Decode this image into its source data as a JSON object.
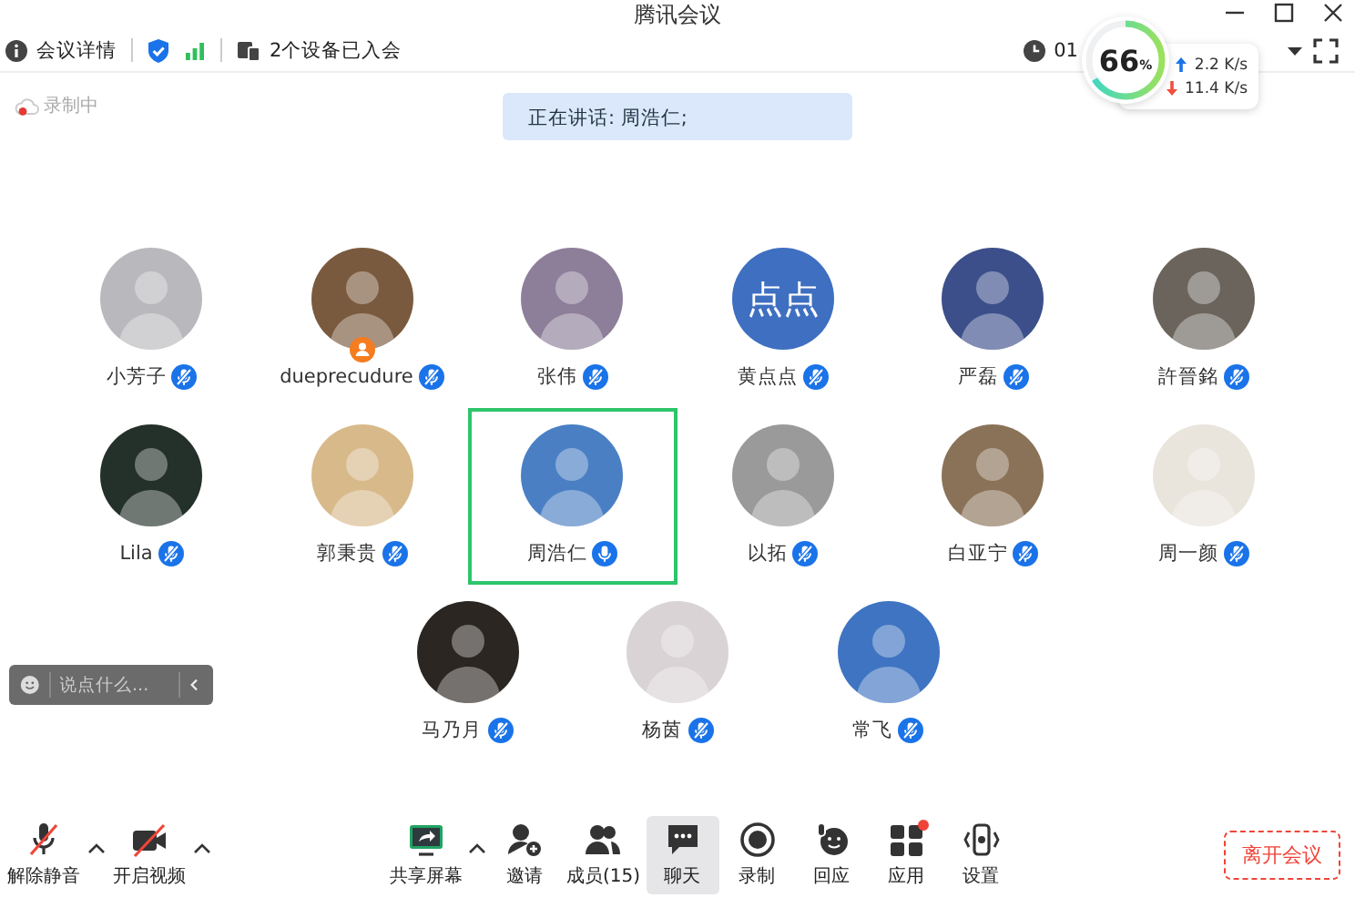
{
  "window": {
    "title": "腾讯会议"
  },
  "info_bar": {
    "details": "会议详情",
    "devices": "2个设备已入会",
    "timer": "01"
  },
  "network": {
    "quality": "66",
    "unit": "%",
    "level": 0.66,
    "upload": "2.2 K/s",
    "download": "11.4 K/s"
  },
  "recording": {
    "label": "录制中"
  },
  "speaker_banner": "正在讲话: 周浩仁;",
  "rows": [
    {
      "participants": [
        {
          "name": "小芳子",
          "muted": true,
          "speaking": false,
          "host": false,
          "avatar": {
            "kind": "photo",
            "color": "#b9b9bd"
          }
        },
        {
          "name": "dueprecudure",
          "muted": true,
          "speaking": false,
          "host": true,
          "avatar": {
            "kind": "photo",
            "color": "#7a5a3e"
          }
        },
        {
          "name": "张伟",
          "muted": true,
          "speaking": false,
          "host": false,
          "avatar": {
            "kind": "photo",
            "color": "#8d7f9a"
          }
        },
        {
          "name": "黄点点",
          "muted": true,
          "speaking": false,
          "host": false,
          "avatar": {
            "kind": "text",
            "text": "点点",
            "color": "#3e6fc0"
          }
        },
        {
          "name": "严磊",
          "muted": true,
          "speaking": false,
          "host": false,
          "avatar": {
            "kind": "photo",
            "color": "#3c4f8a"
          }
        },
        {
          "name": "許晉銘",
          "muted": true,
          "speaking": false,
          "host": false,
          "avatar": {
            "kind": "photo",
            "color": "#6b645c"
          }
        }
      ]
    },
    {
      "participants": [
        {
          "name": "Lila",
          "muted": true,
          "speaking": false,
          "host": false,
          "avatar": {
            "kind": "photo",
            "color": "#24302a"
          }
        },
        {
          "name": "郭秉贵",
          "muted": true,
          "speaking": false,
          "host": false,
          "avatar": {
            "kind": "photo",
            "color": "#d8b98a"
          }
        },
        {
          "name": "周浩仁",
          "muted": false,
          "speaking": true,
          "host": false,
          "avatar": {
            "kind": "photo",
            "color": "#4a7fc4"
          }
        },
        {
          "name": "以拓",
          "muted": true,
          "speaking": false,
          "host": false,
          "avatar": {
            "kind": "photo",
            "color": "#9a9a9a"
          }
        },
        {
          "name": "白亚宁",
          "muted": true,
          "speaking": false,
          "host": false,
          "avatar": {
            "kind": "photo",
            "color": "#8a7258"
          }
        },
        {
          "name": "周一颜",
          "muted": true,
          "speaking": false,
          "host": false,
          "avatar": {
            "kind": "photo",
            "color": "#e9e4dc"
          }
        }
      ]
    },
    {
      "participants": [
        {
          "name": "马乃月",
          "muted": true,
          "speaking": false,
          "host": false,
          "avatar": {
            "kind": "photo",
            "color": "#2b2622"
          }
        },
        {
          "name": "杨茵",
          "muted": true,
          "speaking": false,
          "host": false,
          "avatar": {
            "kind": "photo",
            "color": "#d9d3d6"
          }
        },
        {
          "name": "常飞",
          "muted": true,
          "speaking": false,
          "host": false,
          "avatar": {
            "kind": "photo",
            "color": "#3f74c2"
          }
        }
      ]
    }
  ],
  "chat_box": {
    "placeholder": "说点什么..."
  },
  "toolbar": [
    {
      "kind": "mic",
      "label": "解除静音",
      "has_menu": true,
      "selected": false,
      "badge": false
    },
    {
      "kind": "video",
      "label": "开启视频",
      "has_menu": true,
      "selected": false,
      "badge": false
    },
    {
      "kind": "share",
      "label": "共享屏幕",
      "has_menu": true,
      "selected": false,
      "badge": false
    },
    {
      "kind": "invite",
      "label": "邀请",
      "has_menu": false,
      "selected": false,
      "badge": false
    },
    {
      "kind": "members",
      "label": "成员(15)",
      "has_menu": false,
      "selected": false,
      "badge": false
    },
    {
      "kind": "chat",
      "label": "聊天",
      "has_menu": false,
      "selected": true,
      "badge": false
    },
    {
      "kind": "record",
      "label": "录制",
      "has_menu": false,
      "selected": false,
      "badge": false
    },
    {
      "kind": "react",
      "label": "回应",
      "has_menu": false,
      "selected": false,
      "badge": false
    },
    {
      "kind": "apps",
      "label": "应用",
      "has_menu": false,
      "selected": false,
      "badge": true
    },
    {
      "kind": "settings",
      "label": "设置",
      "has_menu": false,
      "selected": false,
      "badge": false
    }
  ],
  "leave_button": "离开会议"
}
